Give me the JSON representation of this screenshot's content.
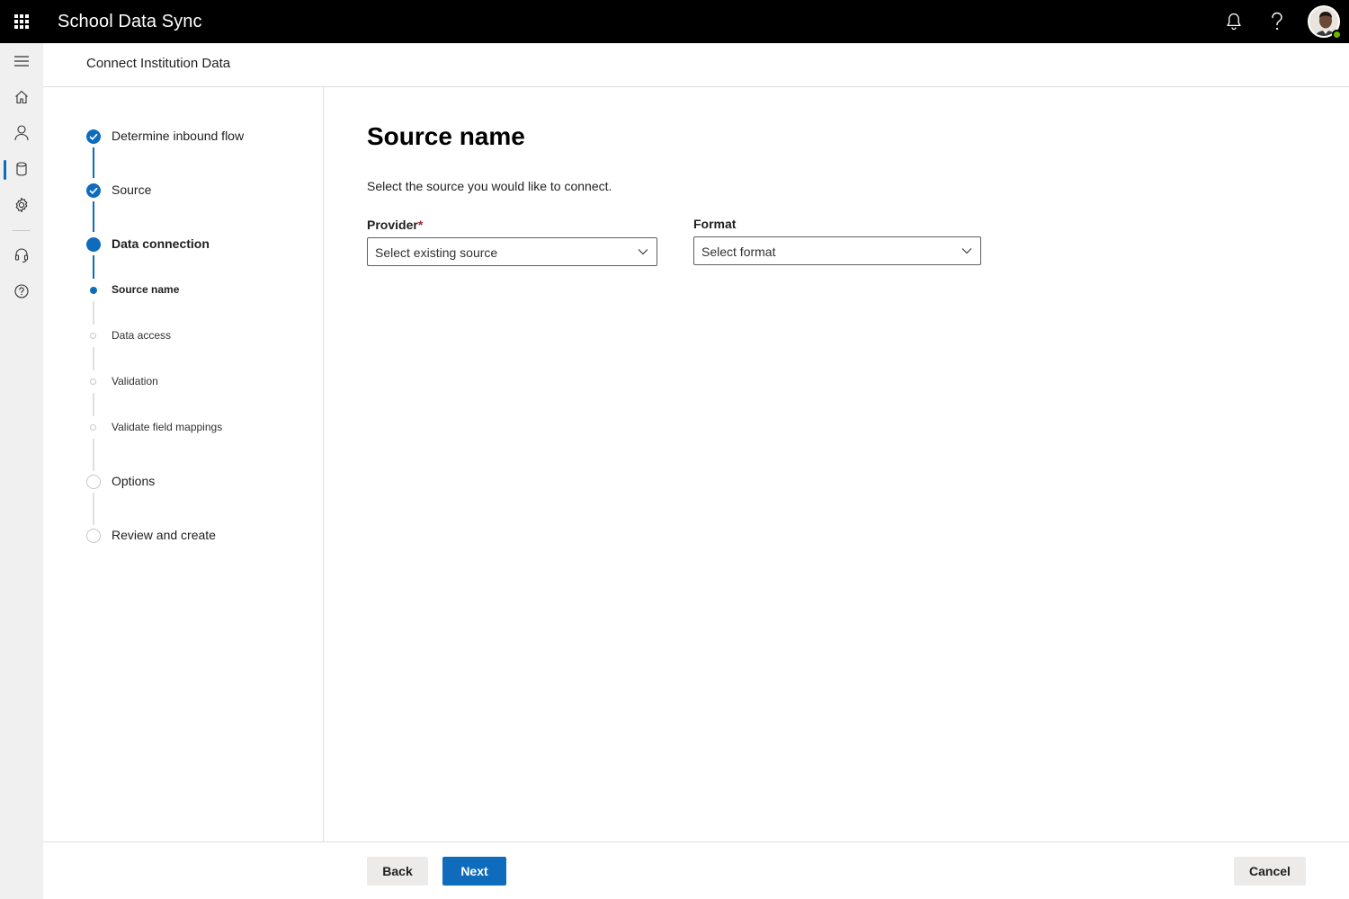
{
  "app": {
    "title": "School Data Sync"
  },
  "topbar": {
    "icons": [
      "waffle-icon",
      "bell-icon",
      "help-icon",
      "avatar"
    ]
  },
  "rail": {
    "items": [
      "menu-icon",
      "home-icon",
      "person-icon",
      "database-icon",
      "gear-icon",
      "headset-icon",
      "help-circle-icon"
    ],
    "active": "database-icon"
  },
  "header": {
    "title": "Connect Institution Data"
  },
  "steps": {
    "items": [
      {
        "label": "Determine inbound flow",
        "state": "done"
      },
      {
        "label": "Source",
        "state": "done"
      },
      {
        "label": "Data connection",
        "state": "current"
      },
      {
        "label": "Source name",
        "state": "current-sub"
      },
      {
        "label": "Data access",
        "state": "todo-sub"
      },
      {
        "label": "Validation",
        "state": "todo-sub"
      },
      {
        "label": "Validate field mappings",
        "state": "todo-sub"
      },
      {
        "label": "Options",
        "state": "todo"
      },
      {
        "label": "Review and create",
        "state": "todo"
      }
    ]
  },
  "main": {
    "title": "Source name",
    "description": "Select the source you would like to connect.",
    "provider": {
      "label": "Provider",
      "required_mark": "*",
      "value": "Select existing source"
    },
    "format": {
      "label": "Format",
      "value": "Select format"
    }
  },
  "footer": {
    "back_label": "Back",
    "next_label": "Next",
    "cancel_label": "Cancel"
  },
  "colors": {
    "accent": "#0f6cbd",
    "topbar": "#000000",
    "rail": "#f0f0f0",
    "presence": "#6bb700",
    "required": "#a4262c"
  }
}
